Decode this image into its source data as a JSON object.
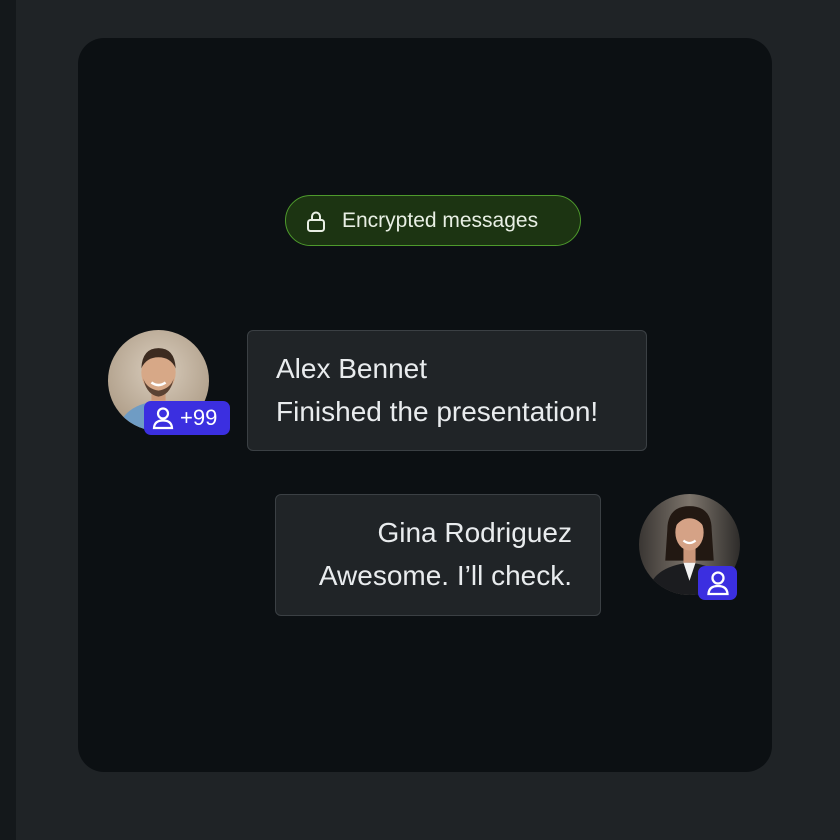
{
  "banner": {
    "icon": "lock-icon",
    "label": "Encrypted messages",
    "bg_color": "#1c3412",
    "border_color": "#4e9a2c"
  },
  "messages": [
    {
      "sender": "Alex Bennet",
      "text": "Finished the presentation!",
      "avatar_icon": "avatar-alex",
      "badge": {
        "icon": "user-icon",
        "count": "+99"
      }
    },
    {
      "sender": "Gina Rodriguez",
      "text": "Awesome. I’ll check.",
      "avatar_icon": "avatar-gina",
      "badge": {
        "icon": "user-icon"
      }
    }
  ],
  "colors": {
    "badge": "#3b2fe0",
    "card_bg": "#0c1013",
    "bubble_bg": "#202427"
  }
}
